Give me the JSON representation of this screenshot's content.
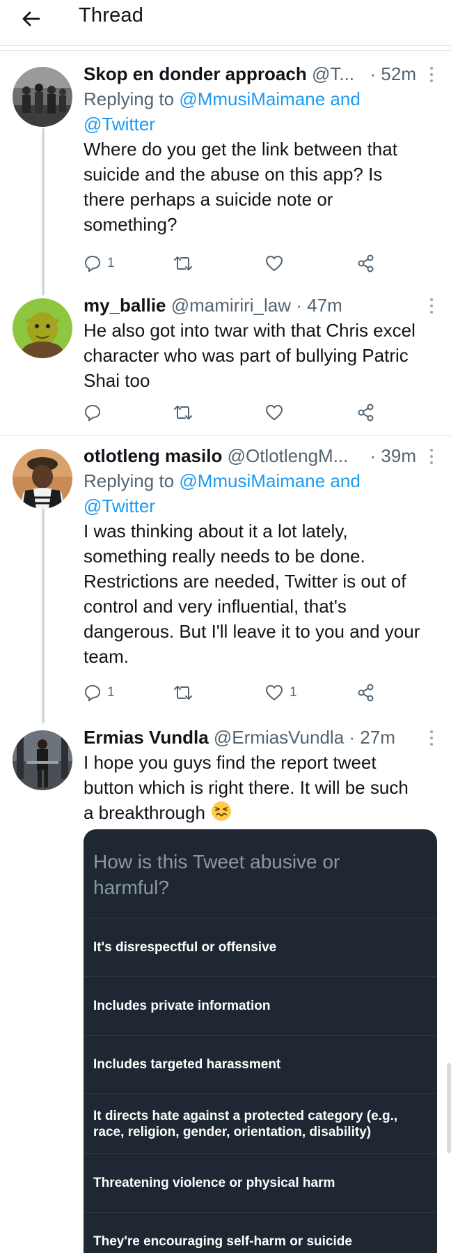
{
  "header": {
    "title": "Thread"
  },
  "tweets": [
    {
      "name": "Skop en donder approach",
      "handle": "@T...",
      "time": "· 52m",
      "reply_prefix": "Replying to ",
      "reply_link1": "@MmusiMaimane and",
      "reply_link2": "@Twitter",
      "text_lines": [
        "Where do you get the link between that",
        "suicide and the abuse on this app? Is",
        "there perhaps a suicide note or",
        "something?"
      ],
      "reply_count": "1",
      "like_count": ""
    },
    {
      "name": "my_ballie",
      "handle": "@mamiriri_law · 47m",
      "time": "",
      "text_lines": [
        "He also got into twar with that Chris excel",
        "character who was part of bullying Patric",
        "Shai too"
      ],
      "reply_count": "",
      "like_count": ""
    },
    {
      "name": "otlotleng masilo",
      "handle": "@OtlotlengM...",
      "time": "· 39m",
      "reply_prefix": "Replying to ",
      "reply_link1": "@MmusiMaimane and",
      "reply_link2": "@Twitter",
      "text_lines": [
        "I was thinking about it a lot lately,",
        "something really needs to be done.",
        "Restrictions are needed, Twitter is out of",
        "control and very influential, that's",
        "dangerous. But I'll leave it to you and your",
        "team."
      ],
      "reply_count": "1",
      "like_count": "1"
    },
    {
      "name": "Ermias Vundla",
      "handle": "@ErmiasVundla · 27m",
      "time": "",
      "text_lines": [
        "I hope you guys find the report tweet",
        "button which is right there. It will be such",
        "a breakthrough"
      ]
    }
  ],
  "report_card": {
    "question_line1": "How is this Tweet abusive or",
    "question_line2": "harmful?",
    "options": [
      "It's disrespectful or offensive",
      "Includes private information",
      "Includes targeted harassment",
      "It directs hate against a protected category (e.g.,",
      "race, religion, gender, orientation, disability)",
      "Threatening violence or physical harm",
      "They're encouraging self-harm or suicide"
    ]
  },
  "colors": {
    "link": "#1d9bf0",
    "muted": "#536471",
    "card_bg": "#1e2732",
    "card_text": "#ffffff",
    "card_question": "#8b98a5"
  },
  "icons": [
    "back-arrow-icon",
    "more-icon",
    "reply-icon",
    "retweet-icon",
    "like-icon",
    "share-icon",
    "grimace-emoji-icon"
  ]
}
